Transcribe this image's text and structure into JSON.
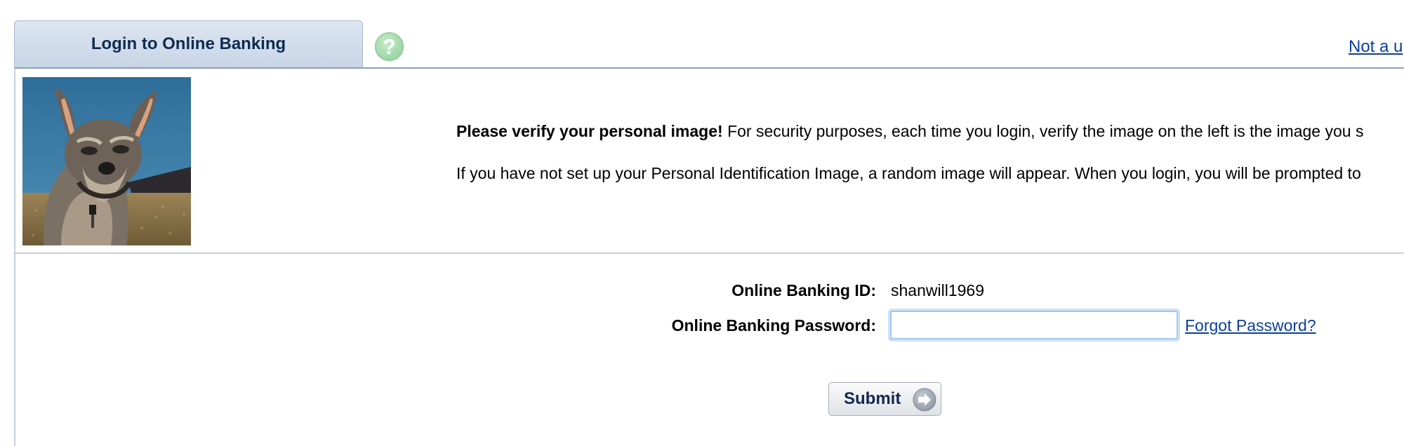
{
  "tab": {
    "title": "Login to Online Banking"
  },
  "help": {
    "icon": "question-icon",
    "glyph": "?"
  },
  "top_link": {
    "label": "Not a u"
  },
  "verification": {
    "heading": "Please verify your personal image!",
    "body": "For security purposes, each time you login, verify the image on the left is the image you s",
    "random_note": "If you have not set up your Personal Identification Image, a random image will appear. When you login, you will be prompted to"
  },
  "form": {
    "id_label": "Online Banking ID:",
    "id_value": "shanwill1969",
    "password_label": "Online Banking Password:",
    "password_value": "",
    "forgot_label": "Forgot Password?",
    "submit_label": "Submit"
  },
  "colors": {
    "tab_text": "#102a52",
    "link": "#0b3f9e",
    "help_icon": "#8ccd95"
  }
}
